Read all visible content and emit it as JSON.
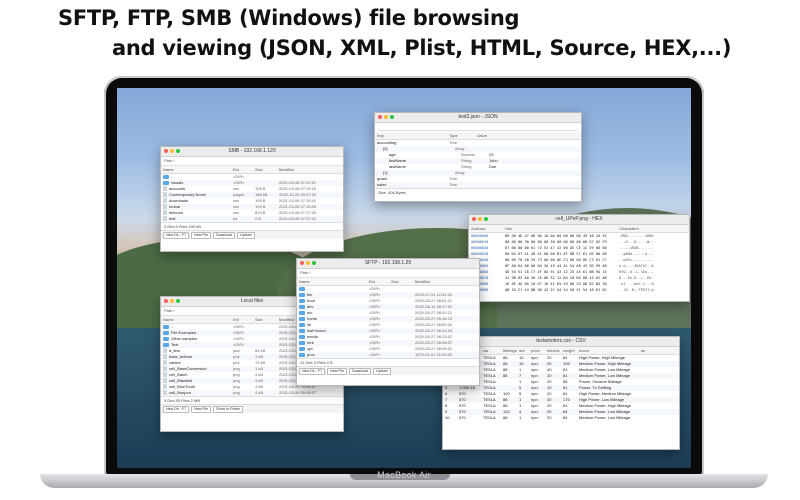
{
  "headline": {
    "line1": "SFTP, FTP, SMB (Windows) file browsing",
    "line2": "and viewing (JSON, XML, Plist, HTML, Source, HEX,...)"
  },
  "device_label": "MacBook Air",
  "smb": {
    "title": "SMB - 192.168.1.120",
    "path_label": "Path",
    "path": "/",
    "columns": [
      "Name",
      "Ext",
      "Size",
      "Modified"
    ],
    "rows": [
      {
        "name": "..",
        "ext": "<DIR>",
        "size": "",
        "mod": ""
      },
      {
        "name": "visuals",
        "ext": "<DIR>",
        "size": "",
        "mod": "2021-03-08 07:22:51"
      },
      {
        "name": "accounts",
        "ext": "csv",
        "size": "109 B",
        "mod": "2021-03-06 07:15:25"
      },
      {
        "name": "Contemporary Novel",
        "ext": "pages",
        "size": "188 kB",
        "mod": "2020-10-29 09:57:03"
      },
      {
        "name": "downloads",
        "ext": "csv",
        "size": "109 B",
        "mod": "2021-03-06 07:15:41"
      },
      {
        "name": "foobar",
        "ext": "csv",
        "size": "109 B",
        "mod": "2021-03-06 07:16:09"
      },
      {
        "name": "telecom",
        "ext": "csv",
        "size": "693 B",
        "mod": "2021-03-06 07:27:03"
      },
      {
        "name": "test",
        "ext": "txt",
        "size": "0 B",
        "mod": "2021-03-06 07:27:22"
      }
    ],
    "status": "2 Dirs 6 Files 190 kB",
    "buttons": [
      "New Dir - F7",
      "New File",
      "Download",
      "Upload"
    ]
  },
  "json": {
    "title": "test2.json - JSON",
    "columns": [
      "Key",
      "Type",
      "Value"
    ],
    "rows": [
      {
        "key": "accounting",
        "type": "Tree",
        "value": ""
      },
      {
        "key": "[0]",
        "type": "Array",
        "value": ""
      },
      {
        "key": "age",
        "type": "Number",
        "value": "23"
      },
      {
        "key": "firstName",
        "type": "String",
        "value": "John"
      },
      {
        "key": "lastName",
        "type": "String",
        "value": "Doe"
      },
      {
        "key": "[1]",
        "type": "Array",
        "value": ""
      },
      {
        "key": "quark",
        "type": "Tree",
        "value": ""
      },
      {
        "key": "sales",
        "type": "Tree",
        "value": ""
      }
    ],
    "status": "Size: 406 Bytes"
  },
  "hex": {
    "title": "cell_UPnP.png - HEX",
    "columns": [
      "Address",
      "Hex",
      "Characters"
    ],
    "rows": [
      {
        "addr": "00000000",
        "hex": "89 50 4E 47 0D 0A 1A 0A 00 00 00 0D 49 48 44 52",
        "chars": ".PNG........IHDR"
      },
      {
        "addr": "00000010",
        "hex": "00 00 00 30 00 00 00 30 08 06 00 00 00 57 02 F9",
        "chars": "...0...0.....W.."
      },
      {
        "addr": "00000020",
        "hex": "87 00 00 00 01 73 52 47 42 00 AE CE 1C E9 00 00",
        "chars": ".....sRGB......."
      },
      {
        "addr": "00000030",
        "hex": "00 04 67 41 4D 41 00 00 B1 8F 0B FC 61 05 00 00",
        "chars": "..gAMA......a..."
      },
      {
        "addr": "00000040",
        "hex": "00 09 70 48 59 73 00 00 0E C3 00 00 0E C3 01 C7",
        "chars": "..pHYs.........."
      },
      {
        "addr": "00000050",
        "hex": "6F A8 64 00 00 04 3A 49 44 41 54 68 43 ED 99 4B",
        "chars": "o.d...:IDAThC..K"
      },
      {
        "addr": "00000060",
        "hex": "48 54 51 18 C7 4F 0A 91 43 12 25 45 61 8B 9A 16",
        "chars": "HTQ..O..C.%Ea..."
      },
      {
        "addr": "00000070",
        "hex": "41 9B 82 A0 36 25 0D 52 12 B4 28 B5 88 45 62 AB",
        "chars": "A...6%.R..(..Eb."
      },
      {
        "addr": "00000080",
        "hex": "16 6E 4A 8A 20 D7 16 41 65 59 08 25 AD 82 B4 30",
        "chars": ".nJ. ..AeY.%...0"
      },
      {
        "addr": "00000090",
        "hex": "AB 16 21 44 8B 96 42 2C A4 54 50 51 54 4A D1 62",
        "chars": "..!D..B,.TPQTJ.b"
      }
    ]
  },
  "sftp": {
    "title": "SFTP - 192.168.1.25",
    "path_label": "Path",
    "path": "/",
    "columns": [
      "Name",
      "Ext",
      "Size",
      "Modified"
    ],
    "rows": [
      {
        "name": "..",
        "ext": "<DIR>",
        "size": "",
        "mod": ""
      },
      {
        "name": "bin",
        "ext": "<DIR>",
        "size": "",
        "mod": "2020-07-01 12:41:03"
      },
      {
        "name": "boot",
        "ext": "<DIR>",
        "size": "",
        "mod": "2020-05-27 08:51:21"
      },
      {
        "name": "dev",
        "ext": "<DIR>",
        "size": "",
        "mod": "2020-08-14 08:17:02"
      },
      {
        "name": "etc",
        "ext": "<DIR>",
        "size": "",
        "mod": "2020-05-27 08:51:21"
      },
      {
        "name": "home",
        "ext": "<DIR>",
        "size": "",
        "mod": "2020-05-27 09:16:19"
      },
      {
        "name": "lib",
        "ext": "<DIR>",
        "size": "",
        "mod": "2020-05-27 08:52:34"
      },
      {
        "name": "lost+found",
        "ext": "<DIR>",
        "size": "",
        "mod": "2020-05-27 08:24:03"
      },
      {
        "name": "media",
        "ext": "<DIR>",
        "size": "",
        "mod": "2020-05-27 08:25:02"
      },
      {
        "name": "mnt",
        "ext": "<DIR>",
        "size": "",
        "mod": "2020-05-27 08:08:37"
      },
      {
        "name": "opt",
        "ext": "<DIR>",
        "size": "",
        "mod": "2020-05-27 08:54:02"
      },
      {
        "name": "proc",
        "ext": "<DIR>",
        "size": "",
        "mod": "1970-01-01 01:00:00"
      }
    ],
    "status": "21 Dirs 0 Files 0 B",
    "buttons": [
      "New Dir - F7",
      "New File",
      "Download",
      "Upload"
    ]
  },
  "local": {
    "title": "Local files",
    "path_label": "Path",
    "path": "/",
    "columns": [
      "Name",
      "Ext",
      "Size",
      "Modified"
    ],
    "rows": [
      {
        "name": "..",
        "ext": "<DIR>",
        "size": "",
        "mod": "2021-03-06 09:12:05"
      },
      {
        "name": "File Examples",
        "ext": "<DIR>",
        "size": "",
        "mod": "2021-03-06 09:08:57"
      },
      {
        "name": "Other samples",
        "ext": "<DIR>",
        "size": "",
        "mod": "2021-03-06 09:08:57"
      },
      {
        "name": "Text",
        "ext": "<DIR>",
        "size": "",
        "mod": "2021-03-06 09:08:57"
      },
      {
        "name": "a_test",
        "ext": "json",
        "size": "64 kB",
        "mod": "2021-03-06 09:08:57"
      },
      {
        "name": "base_bottom",
        "ext": "pml",
        "size": "1 kB",
        "mod": "2021-03-06 09:08:57"
      },
      {
        "name": "cables",
        "ext": "pml",
        "size": "75 kB",
        "mod": "2021-03-06 09:08:57"
      },
      {
        "name": "cell_BaseConversion",
        "ext": "png",
        "size": "1 kB",
        "mod": "2021-03-06 09:08:57"
      },
      {
        "name": "cell_Batch",
        "ext": "png",
        "size": "4 kB",
        "mod": "2021-03-06 09:08:57"
      },
      {
        "name": "cell_Blacklist",
        "ext": "png",
        "size": "4 kB",
        "mod": "2021-03-06 09:08:57"
      },
      {
        "name": "cell_BlueTooth",
        "ext": "png",
        "size": "4 kB",
        "mod": "2021-03-06 09:08:57"
      },
      {
        "name": "cell_Bonjour",
        "ext": "png",
        "size": "4 kB",
        "mod": "2021-03-06 09:08:57"
      }
    ],
    "status": "5 Dirs 55 Files 2 MB",
    "buttons": [
      "New Dir - F7",
      "New File",
      "Show in Finder"
    ]
  },
  "csv": {
    "title": "teslamotors.csv - CSV",
    "columns": [
      "",
      "brand",
      "car",
      "Mileage",
      "adr",
      "price",
      "electric",
      "weight",
      "doors",
      "ac"
    ],
    "rows": [
      [
        "0",
        "570",
        "TESLA",
        "88",
        "15",
        "npn",
        "20",
        "84",
        "High Power, High Mileage"
      ],
      [
        "1",
        "975",
        "TESLA",
        "88",
        "15",
        "npn",
        "20",
        "105",
        "Medium Power, High Mileage"
      ],
      [
        "2",
        "570",
        "TESLA",
        "88",
        "1",
        "npn",
        "40",
        "81",
        "Medium Power, Low Mileage"
      ],
      [
        "3",
        "975",
        "TESLA",
        "88",
        "7",
        "npn",
        "20",
        "81",
        "Medium Power, Low Mileage"
      ],
      [
        "4",
        "",
        "TESLA",
        "",
        "1",
        "npn",
        "20",
        "86",
        "Power, General Mileage"
      ],
      [
        "5",
        "1.05e-16",
        "TESLA",
        "",
        "5",
        "npn",
        "10",
        "81",
        "Power, Tri Settling"
      ],
      [
        "6",
        "570",
        "TESLA",
        "100",
        "5",
        "npn",
        "20",
        "81",
        "High Power, Medium Mileage"
      ],
      [
        "7",
        "570",
        "TESLA",
        "88",
        "1",
        "npn",
        "20",
        "175",
        "High Power, Low Mileage"
      ],
      [
        "8",
        "570",
        "TESLA",
        "88",
        "1",
        "npn",
        "20",
        "81",
        "Medium Power, High Mileage"
      ],
      [
        "9",
        "570",
        "TESLA",
        "132",
        "4",
        "npn",
        "20",
        "84",
        "Medium Power, Low Mileage"
      ],
      [
        "10",
        "570",
        "TESLA",
        "88",
        "1",
        "npn",
        "20",
        "84",
        "Medium Power, Low Mileage"
      ]
    ]
  }
}
